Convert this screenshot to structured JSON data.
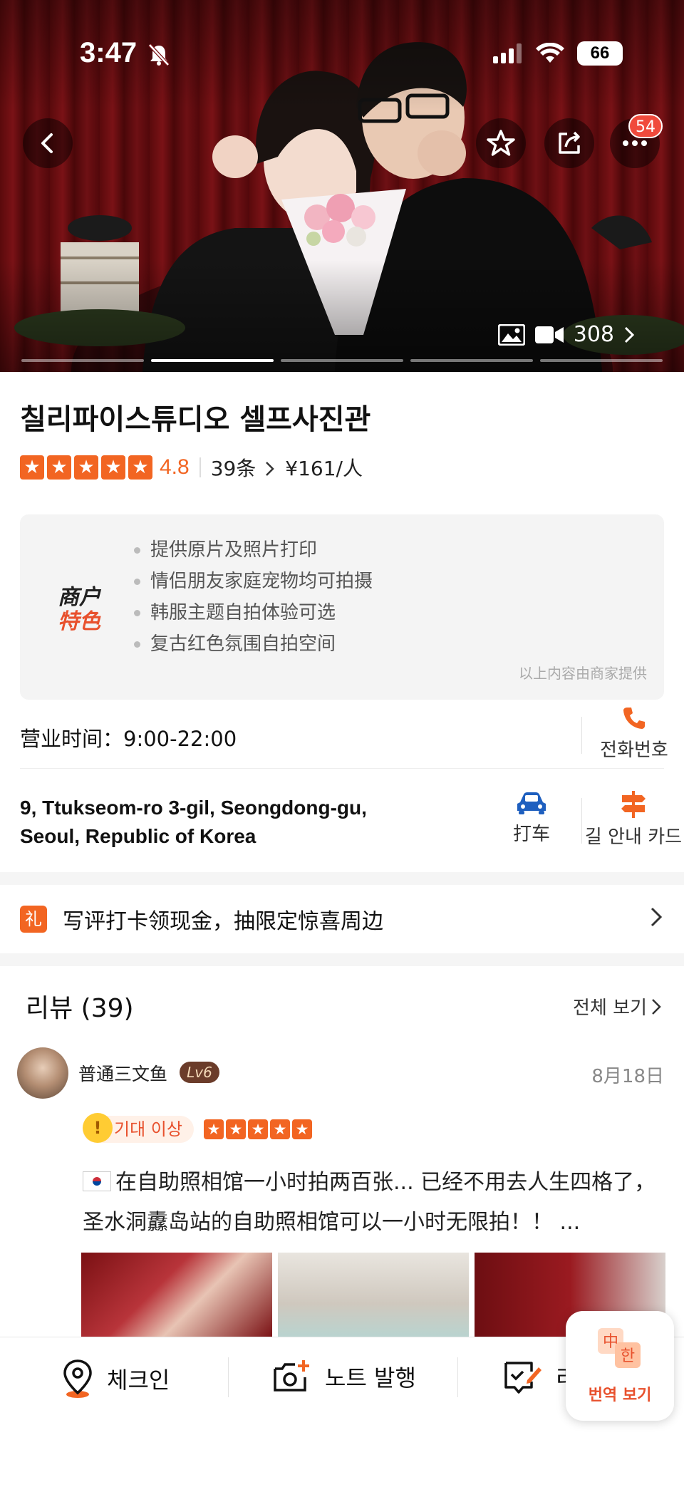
{
  "status_bar": {
    "time": "3:47",
    "battery": "66"
  },
  "hero": {
    "more_badge": "54",
    "media_count": "308"
  },
  "title": "칠리파이스튜디오 셀프사진관",
  "rating": {
    "score": "4.8",
    "reviews_count": "39条",
    "price": "¥161/人"
  },
  "features": {
    "logo_line1": "商户",
    "logo_line2": "特色",
    "items": [
      "提供原片及照片打印",
      "情侣朋友家庭宠物均可拍摄",
      "韩服主题自拍体验可选",
      "复古红色氛围自拍空间"
    ],
    "note": "以上内容由商家提供"
  },
  "hours": "营业时间：9:00-22:00",
  "actions": {
    "phone": "전화번호",
    "taxi": "打车",
    "guide": "길 안내 카드"
  },
  "address": "9, Ttukseom-ro 3-gil, Seongdong-gu, Seoul, Republic of Korea",
  "promo": {
    "badge": "礼",
    "text": "写评打卡领现金，抽限定惊喜周边"
  },
  "reviews": {
    "header": "리뷰 (39)",
    "view_all": "전체 보기",
    "item": {
      "username": "普通三文鱼",
      "level": "Lv6",
      "date": "8月18日",
      "tag": "기대 이상",
      "text": "在自助照相馆一小时拍两百张... 已经不用去人生四格了，圣水洞纛岛站的自助照相馆可以一小时无限拍！！ ..."
    }
  },
  "bottom_bar": {
    "checkin": "체크인",
    "post_note": "노트 발행",
    "review": "리",
    "translate": "번역 보기"
  },
  "colors": {
    "accent": "#f26522",
    "badge_red": "#f04a3c"
  },
  "icons": [
    "back-icon",
    "star-outline-icon",
    "share-icon",
    "more-icon",
    "photo-icon",
    "video-icon",
    "phone-icon",
    "car-icon",
    "signpost-icon",
    "location-pin-icon",
    "camera-plus-icon",
    "edit-review-icon",
    "translate-icon"
  ]
}
